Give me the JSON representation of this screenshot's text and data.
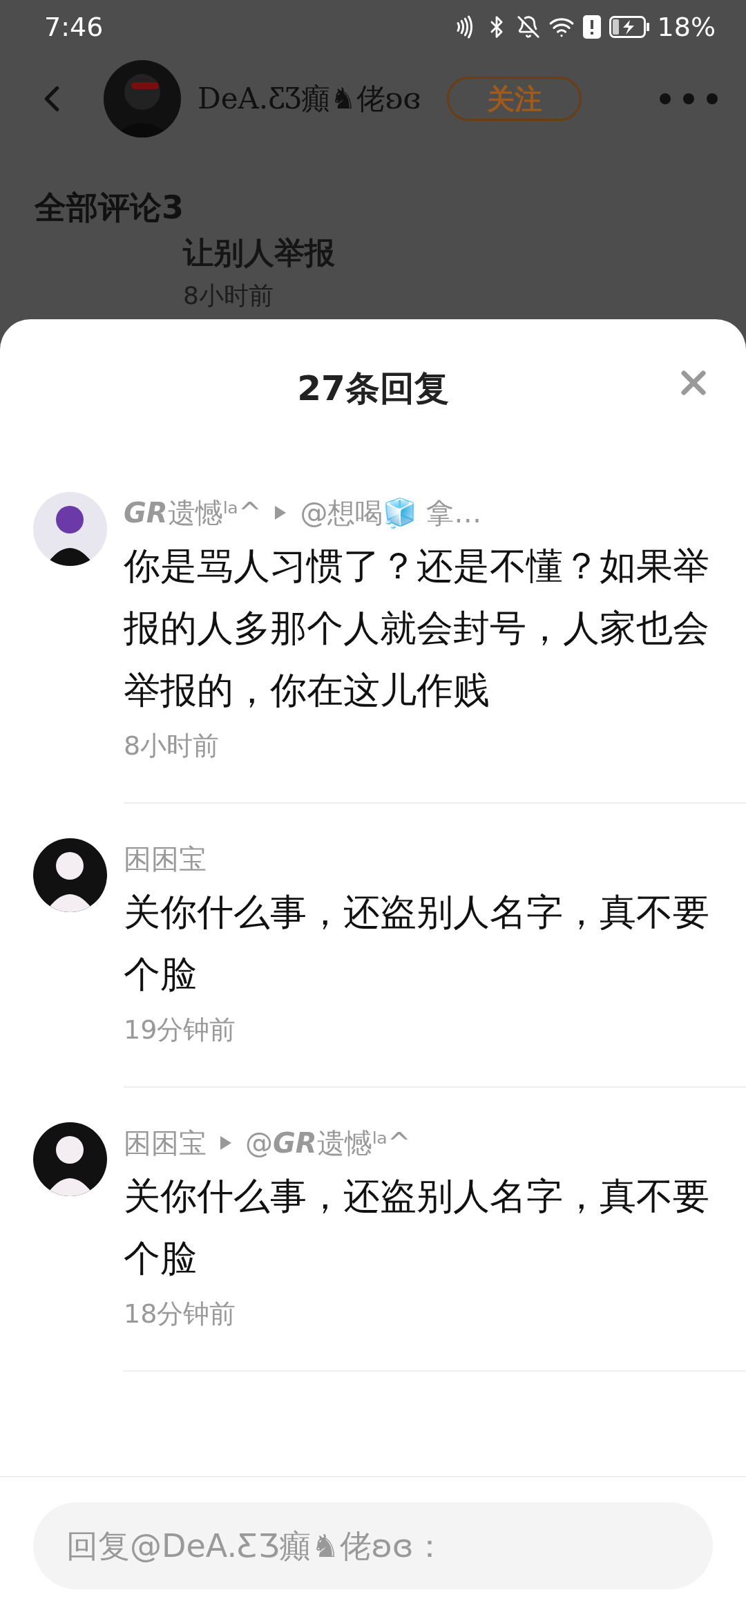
{
  "status_bar": {
    "time": "7:46",
    "battery": "18%"
  },
  "header": {
    "username": "DeA.ƸƷ癲♞佬ʚɞ",
    "follow": "关注"
  },
  "page": {
    "section_title": "全部评论3",
    "partial_comment": {
      "text": "让别人举报",
      "time": "8小时前"
    }
  },
  "sheet": {
    "title": "27条回复",
    "replies": [
      {
        "author": "**GR**遗憾ˡᵃ^",
        "reply_to": "@想喝🧊 拿…",
        "text": "你是骂人习惯了？还是不懂？如果举报的人多那个人就会封号，人家也会举报的，你在这儿作贱",
        "time": "8小时前"
      },
      {
        "author": "困困宝",
        "text": "关你什么事，还盗别人名字，真不要个脸",
        "time": "19分钟前"
      },
      {
        "author": "困困宝",
        "reply_to": "@**GR**遗憾ˡᵃ^",
        "text": "关你什么事，还盗别人名字，真不要个脸",
        "time": "18分钟前"
      }
    ]
  },
  "composer": {
    "placeholder": "回复@DeA.ƸƷ癲♞佬ʚɞ："
  }
}
